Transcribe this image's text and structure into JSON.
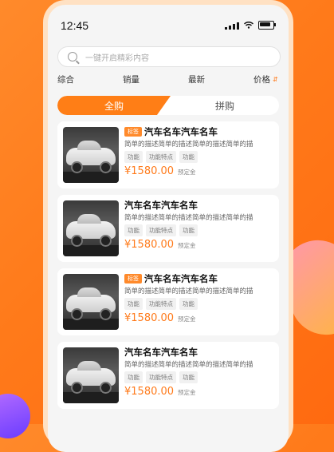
{
  "status_bar": {
    "time": "12:45"
  },
  "search": {
    "placeholder": "一键开启精彩内容"
  },
  "sort_bar": {
    "items": [
      "综合",
      "销量",
      "最新",
      "价格"
    ]
  },
  "tabs": {
    "active": "全购",
    "inactive": "拼购"
  },
  "colors": {
    "accent": "#ff7e16",
    "price": "#ff7a1a",
    "badge": "#ff8a2b"
  },
  "products": [
    {
      "badge": "标签",
      "title": "汽车名车汽车名车",
      "desc": "简单的描述简单的描述简单的描述简单的描",
      "tags": [
        "功能",
        "功能特点",
        "功能"
      ],
      "price": "¥1580.00",
      "deposit": "预定金"
    },
    {
      "badge": "",
      "title": "汽车名车汽车名车",
      "desc": "简单的描述简单的描述简单的描述简单的描",
      "tags": [
        "功能",
        "功能特点",
        "功能"
      ],
      "price": "¥1580.00",
      "deposit": "预定金"
    },
    {
      "badge": "标签",
      "title": "汽车名车汽车名车",
      "desc": "简单的描述简单的描述简单的描述简单的描",
      "tags": [
        "功能",
        "功能特点",
        "功能"
      ],
      "price": "¥1580.00",
      "deposit": "预定金"
    },
    {
      "badge": "",
      "title": "汽车名车汽车名车",
      "desc": "简单的描述简单的描述简单的描述简单的描",
      "tags": [
        "功能",
        "功能特点",
        "功能"
      ],
      "price": "¥1580.00",
      "deposit": "预定金"
    }
  ]
}
